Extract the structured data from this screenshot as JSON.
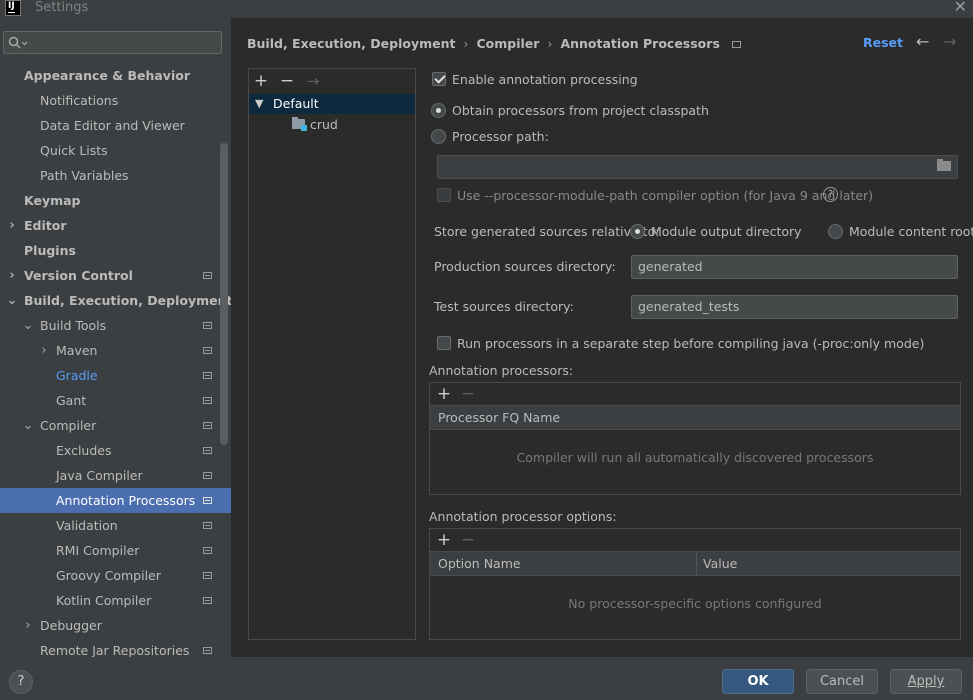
{
  "window": {
    "title": "Settings",
    "app_icon_text": "IJ"
  },
  "sidebar": {
    "search_placeholder": "",
    "items": [
      {
        "label": "Appearance & Behavior"
      },
      {
        "label": "Notifications"
      },
      {
        "label": "Data Editor and Viewer"
      },
      {
        "label": "Quick Lists"
      },
      {
        "label": "Path Variables"
      },
      {
        "label": "Keymap"
      },
      {
        "label": "Editor"
      },
      {
        "label": "Plugins"
      },
      {
        "label": "Version Control"
      },
      {
        "label": "Build, Execution, Deployment"
      },
      {
        "label": "Build Tools"
      },
      {
        "label": "Maven"
      },
      {
        "label": "Gradle"
      },
      {
        "label": "Gant"
      },
      {
        "label": "Compiler"
      },
      {
        "label": "Excludes"
      },
      {
        "label": "Java Compiler"
      },
      {
        "label": "Annotation Processors"
      },
      {
        "label": "Validation"
      },
      {
        "label": "RMI Compiler"
      },
      {
        "label": "Groovy Compiler"
      },
      {
        "label": "Kotlin Compiler"
      },
      {
        "label": "Debugger"
      },
      {
        "label": "Remote Jar Repositories"
      }
    ]
  },
  "header": {
    "breadcrumb": [
      "Build, Execution, Deployment",
      "Compiler",
      "Annotation Processors"
    ],
    "separator": "›",
    "reset_label": "Reset"
  },
  "profiles": {
    "add": "+",
    "remove": "−",
    "move": "→",
    "default_label": "Default",
    "module_label": "crud"
  },
  "form": {
    "enable_processing": "Enable annotation processing",
    "obtain_from_classpath": "Obtain processors from project classpath",
    "processor_path": "Processor path:",
    "processor_path_value": "",
    "module_path_option": "Use --processor-module-path compiler option (for Java 9 and later)",
    "store_relative_to": "Store generated sources relative to:",
    "module_output_dir": "Module output directory",
    "module_content_root": "Module content root",
    "production_dir_label": "Production sources directory:",
    "production_dir_value": "generated",
    "test_dir_label": "Test sources directory:",
    "test_dir_value": "generated_tests",
    "separate_step": "Run processors in a separate step before compiling java (-proc:only mode)"
  },
  "processors_table": {
    "title": "Annotation processors:",
    "column": "Processor FQ Name",
    "empty_text": "Compiler will run all automatically discovered processors"
  },
  "options_table": {
    "title": "Annotation processor options:",
    "columns": [
      "Option Name",
      "Value"
    ],
    "empty_text": "No processor-specific options configured"
  },
  "buttons": {
    "help": "?",
    "ok": "OK",
    "cancel": "Cancel",
    "apply": "Apply"
  }
}
